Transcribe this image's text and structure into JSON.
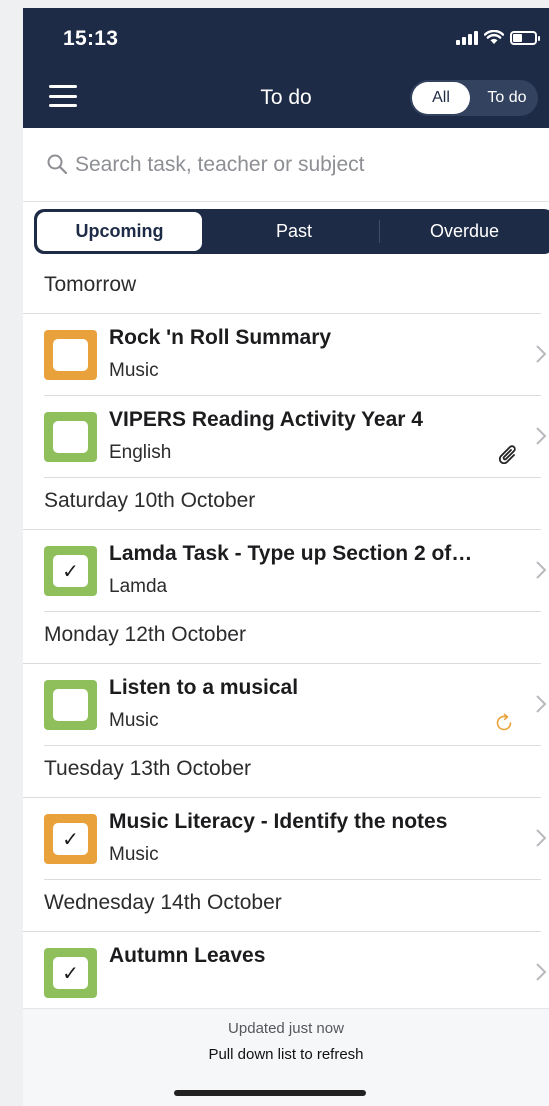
{
  "status_bar": {
    "time": "15:13"
  },
  "nav": {
    "title": "To do",
    "filter_options": [
      "All",
      "To do"
    ],
    "filter_selected": "All"
  },
  "search": {
    "placeholder": "Search task, teacher or subject"
  },
  "tabs": {
    "upcoming": "Upcoming",
    "past": "Past",
    "overdue": "Overdue",
    "selected": "Upcoming"
  },
  "groups": [
    {
      "date": "Tomorrow",
      "tasks": [
        {
          "title": "Rock 'n Roll Summary",
          "subject": "Music",
          "color": "#e9a23b",
          "checked": false,
          "icon": ""
        },
        {
          "title": "VIPERS Reading Activity Year 4",
          "subject": "English",
          "color": "#8fbf5a",
          "checked": false,
          "icon": "paperclip-icon"
        }
      ]
    },
    {
      "date": "Saturday 10th October",
      "tasks": [
        {
          "title": "Lamda Task - Type up Section 2 of…",
          "subject": "Lamda",
          "color": "#8fbf5a",
          "checked": true,
          "icon": ""
        }
      ]
    },
    {
      "date": "Monday 12th October",
      "tasks": [
        {
          "title": "Listen to a musical",
          "subject": "Music",
          "color": "#8fbf5a",
          "checked": false,
          "icon": "repeat-icon"
        }
      ]
    },
    {
      "date": "Tuesday 13th October",
      "tasks": [
        {
          "title": "Music Literacy - Identify the notes",
          "subject": "Music",
          "color": "#e9a23b",
          "checked": true,
          "icon": ""
        }
      ]
    },
    {
      "date": "Wednesday 14th October",
      "tasks": [
        {
          "title": "Autumn Leaves",
          "subject": "",
          "color": "#8fbf5a",
          "checked": true,
          "icon": ""
        }
      ]
    }
  ],
  "footer": {
    "updated": "Updated just now",
    "pull": "Pull down list to refresh"
  },
  "colors": {
    "navy": "#1d2b46",
    "orange": "#e9a23b",
    "green": "#8fbf5a"
  }
}
